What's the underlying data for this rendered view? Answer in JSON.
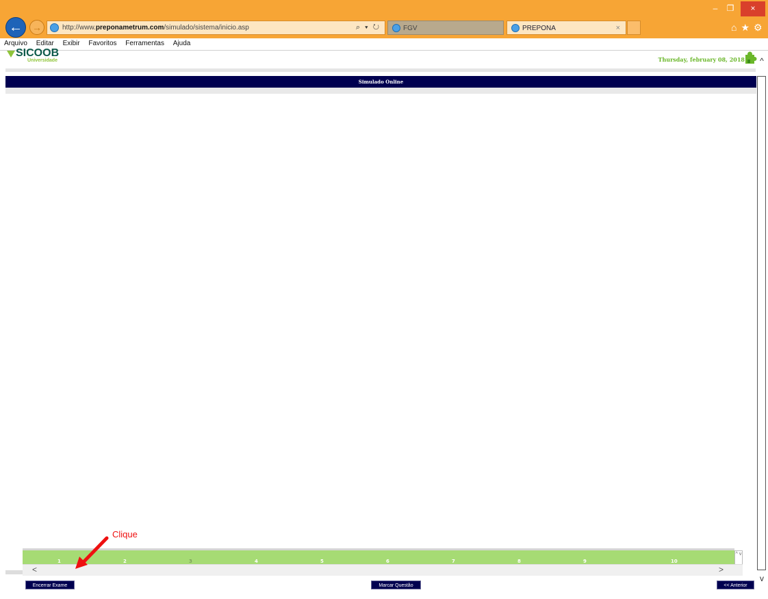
{
  "browser": {
    "url_prefix": "http://www.",
    "url_domain": "preponametrum.com",
    "url_path": "/simulado/sistema/inicio.asp",
    "search_refresh": "⌕ ▾ ↻",
    "tabs": [
      {
        "label": "FGV"
      },
      {
        "label": "PREPONA",
        "close": "×"
      }
    ],
    "window_controls": {
      "minimize": "–",
      "restore": "❐",
      "close": "×"
    },
    "toolbar_icons": "⌂★⚙"
  },
  "menu": [
    "Arquivo",
    "Editar",
    "Exibir",
    "Favoritos",
    "Ferramentas",
    "Ajuda"
  ],
  "header": {
    "logo_brand": "SICOOB",
    "logo_sub": "Universidade",
    "date": "Thursday, february 08, 2018",
    "title": "Simulado Online"
  },
  "questions": [
    "1",
    "2",
    "3",
    "4",
    "5",
    "6",
    "7",
    "8",
    "9",
    "10"
  ],
  "scroll_glyphs": {
    "left": "<",
    "right": ">",
    "up": "^",
    "down": "v",
    "spin": "^ v"
  },
  "buttons": {
    "end_exam": "Encerrar Exame",
    "mark_question": "Marcar Questão",
    "previous": "<< Anterior"
  },
  "annotation": {
    "text": "Clique"
  },
  "colors": {
    "chrome": "#f7a535",
    "header_bar": "#000050",
    "question_strip": "#a6db74",
    "date_text": "#6ab72a",
    "annotation": "#ee1010"
  }
}
